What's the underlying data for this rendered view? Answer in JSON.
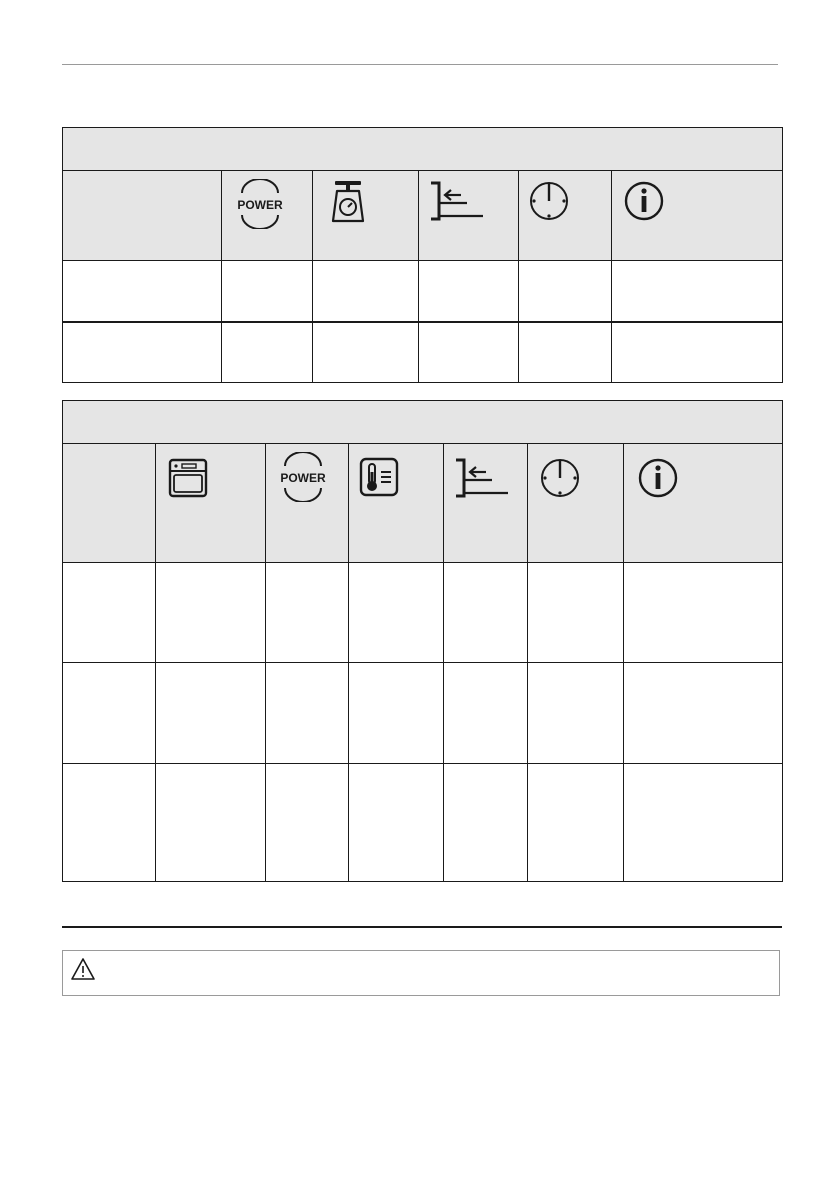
{
  "icons": {
    "power_label": "POWER",
    "power": "power-icon",
    "scale": "weight-scale-icon",
    "shelf": "shelf-position-icon",
    "clock": "clock-icon",
    "info": "info-icon",
    "oven": "oven-function-icon",
    "thermometer": "temperature-icon",
    "warning": "warning-triangle-icon"
  },
  "table1": {
    "title": "",
    "rows": [
      [
        "",
        "",
        "",
        "",
        "",
        ""
      ],
      [
        "",
        "",
        "",
        "",
        "",
        ""
      ]
    ]
  },
  "table2": {
    "title": "",
    "rows": [
      [
        "",
        "",
        "",
        "",
        "",
        "",
        ""
      ],
      [
        "",
        "",
        "",
        "",
        "",
        "",
        ""
      ],
      [
        "",
        "",
        "",
        "",
        "",
        "",
        ""
      ]
    ]
  },
  "warning": {
    "text": ""
  }
}
